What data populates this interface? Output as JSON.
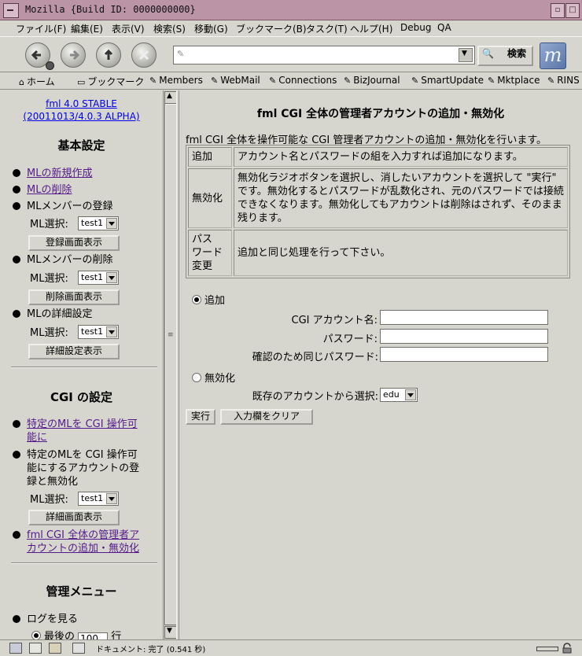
{
  "window": {
    "title": "Mozilla {Build ID: 0000000000}"
  },
  "menubar": [
    "ファイル(F)",
    "編集(E)",
    "表示(V)",
    "検索(S)",
    "移動(G)",
    "ブックマーク(B)",
    "タスク(T)",
    "ヘルプ(H)",
    "Debug",
    "QA"
  ],
  "toolbar": {
    "search_label": "検索",
    "url_value": ""
  },
  "personalbar": [
    "ホーム",
    "ブックマーク",
    "Members",
    "WebMail",
    "Connections",
    "BizJournal",
    "SmartUpdate",
    "Mktplace",
    "RINS"
  ],
  "sidebar": {
    "version_line1": "fml 4.0 STABLE",
    "version_line2": "(20011013/4.0.3 ALPHA)",
    "basic_heading": "基本設定",
    "items": {
      "ml_new": "MLの新規作成",
      "ml_delete": "MLの削除",
      "member_add": "MLメンバーの登録",
      "member_remove": "MLメンバーの削除",
      "ml_detail": "MLの詳細設定"
    },
    "ml_select_label": "ML選択:",
    "ml_select_value": "test1",
    "register_btn": "登録画面表示",
    "delete_btn": "削除画面表示",
    "detail_btn": "詳細設定表示",
    "cgi_heading": "CGI の設定",
    "cgi_item1_l1": "特定のMLを CGI 操作可",
    "cgi_item1_l2": "能に",
    "cgi_item2_l1": "特定のMLを CGI 操作可",
    "cgi_item2_l2": "能にするアカウントの登",
    "cgi_item2_l3": "録と無効化",
    "detail_screen_btn": "詳細画面表示",
    "cgi_item3_l1": "fml CGI 全体の管理者ア",
    "cgi_item3_l2": "カウントの追加・無効化",
    "admin_heading": "管理メニュー",
    "log_item": "ログを見る",
    "log_last_prefix": "最後の",
    "log_last_value": "100",
    "log_last_suffix": "行"
  },
  "main": {
    "title": "fml CGI 全体の管理者アカウントの追加・無効化",
    "intro": "fml CGI 全体を操作可能な CGI 管理者アカウントの追加・無効化を行います。",
    "table": [
      {
        "head": "追加",
        "desc": "アカウント名とパスワードの組を入力すれば追加になります。"
      },
      {
        "head": "無効化",
        "desc": "無効化ラジオボタンを選択し、消したいアカウントを選択して \"実行\" です。無効化するとパスワードが乱数化され、元のパスワードでは接続できなくなります。無効化してもアカウントは削除はされず、そのまま残ります。"
      },
      {
        "head_l1": "パス",
        "head_l2": "ワード",
        "head_l3": "変更",
        "desc": "追加と同じ処理を行って下さい。"
      }
    ],
    "radio_add": "追加",
    "account_label": "CGI アカウント名:",
    "password_label": "パスワード:",
    "confirm_label": "確認のため同じパスワード:",
    "radio_disable": "無効化",
    "existing_label": "既存のアカウントから選択:",
    "existing_value": "edu",
    "run_btn": "実行",
    "clear_btn": "入力欄をクリア"
  },
  "status": {
    "text": "ドキュメント: 完了 (0.541 秒)"
  }
}
